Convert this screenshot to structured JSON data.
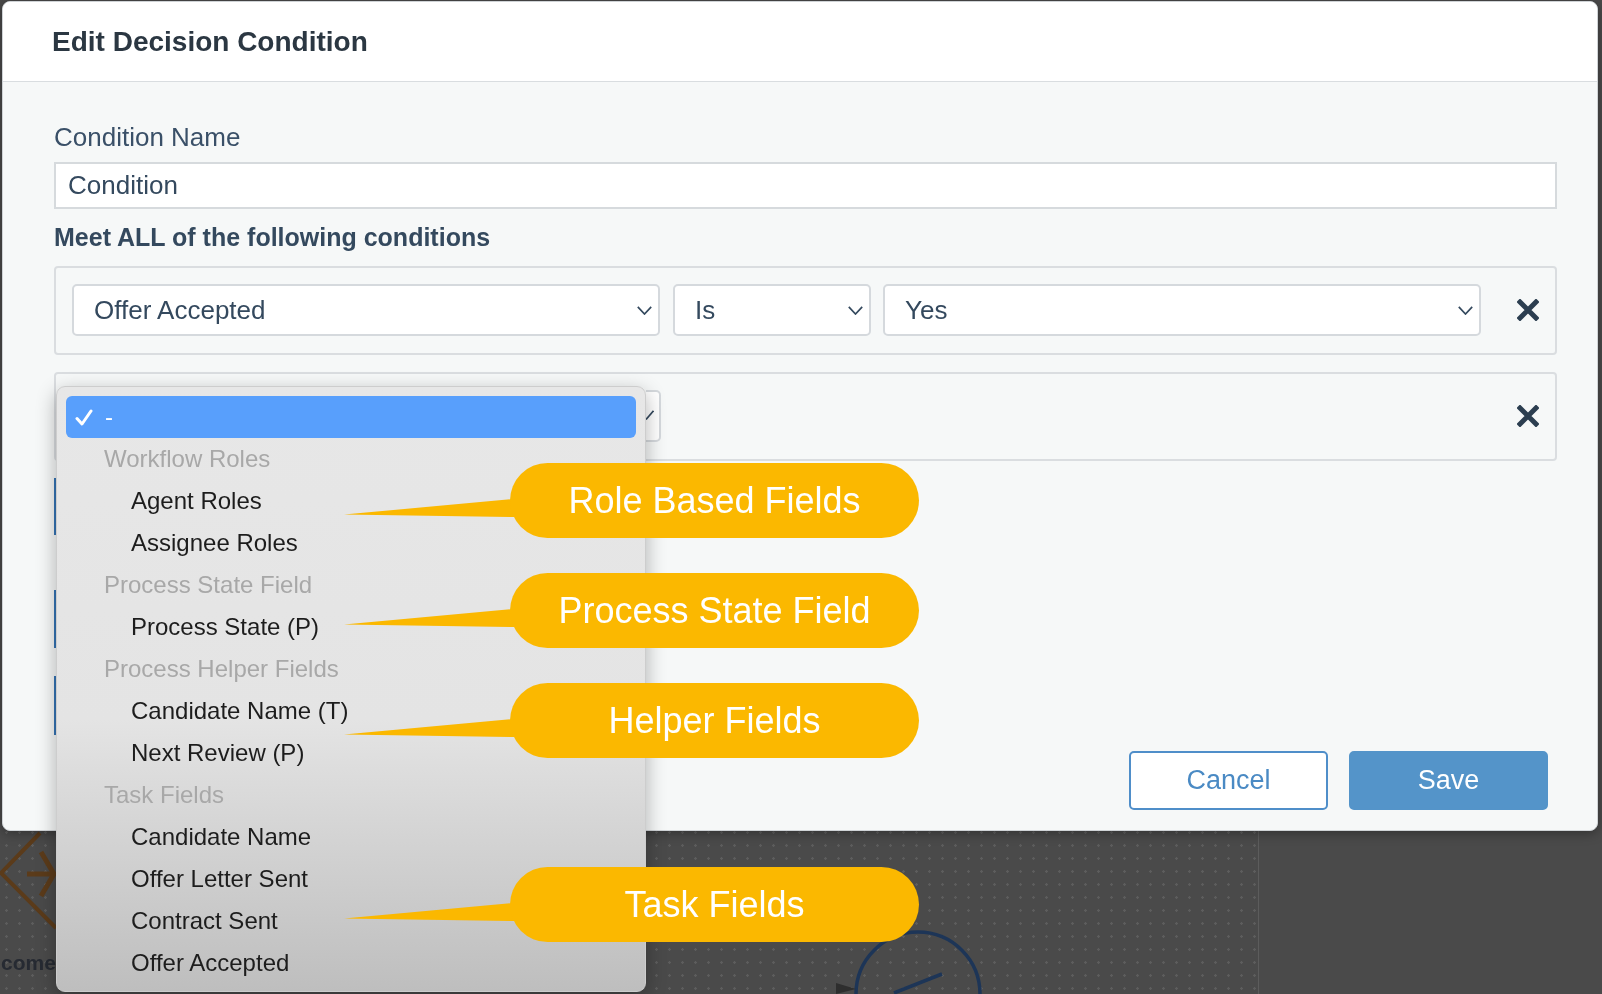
{
  "dialog": {
    "title": "Edit Decision Condition"
  },
  "condition_name": {
    "label": "Condition Name",
    "value": "Condition"
  },
  "conditions": {
    "heading": "Meet ALL of the following conditions",
    "rows": [
      {
        "kind": "full",
        "field": "Offer Accepted",
        "operator": "Is",
        "value": "Yes"
      },
      {
        "kind": "covered"
      }
    ]
  },
  "dropdown": {
    "items": [
      {
        "kind": "option",
        "label": "-",
        "selected": true
      },
      {
        "kind": "group",
        "label": "Workflow Roles",
        "children": [
          {
            "label": "Agent Roles",
            "selected": false
          },
          {
            "label": "Assignee Roles",
            "selected": false
          }
        ]
      },
      {
        "kind": "group",
        "label": "Process State Field",
        "children": [
          {
            "label": "Process State (P)",
            "selected": false
          }
        ]
      },
      {
        "kind": "group",
        "label": "Process Helper Fields",
        "children": [
          {
            "label": "Candidate Name (T)",
            "selected": false
          },
          {
            "label": "Next Review (P)",
            "selected": false
          }
        ]
      },
      {
        "kind": "group",
        "label": "Task Fields",
        "children": [
          {
            "label": "Candidate Name",
            "selected": false
          },
          {
            "label": "Offer Letter Sent",
            "selected": false
          },
          {
            "label": "Contract Sent",
            "selected": false
          },
          {
            "label": "Offer Accepted",
            "selected": false
          }
        ]
      }
    ]
  },
  "callouts": [
    {
      "text": "Role Based Fields"
    },
    {
      "text": "Process State Field"
    },
    {
      "text": "Helper Fields"
    },
    {
      "text": "Task Fields"
    }
  ],
  "buttons": [
    {
      "kind": "secondary",
      "label": "Cancel"
    },
    {
      "kind": "primary",
      "label": "Save"
    }
  ],
  "canvas": {
    "node_label": "come"
  }
}
